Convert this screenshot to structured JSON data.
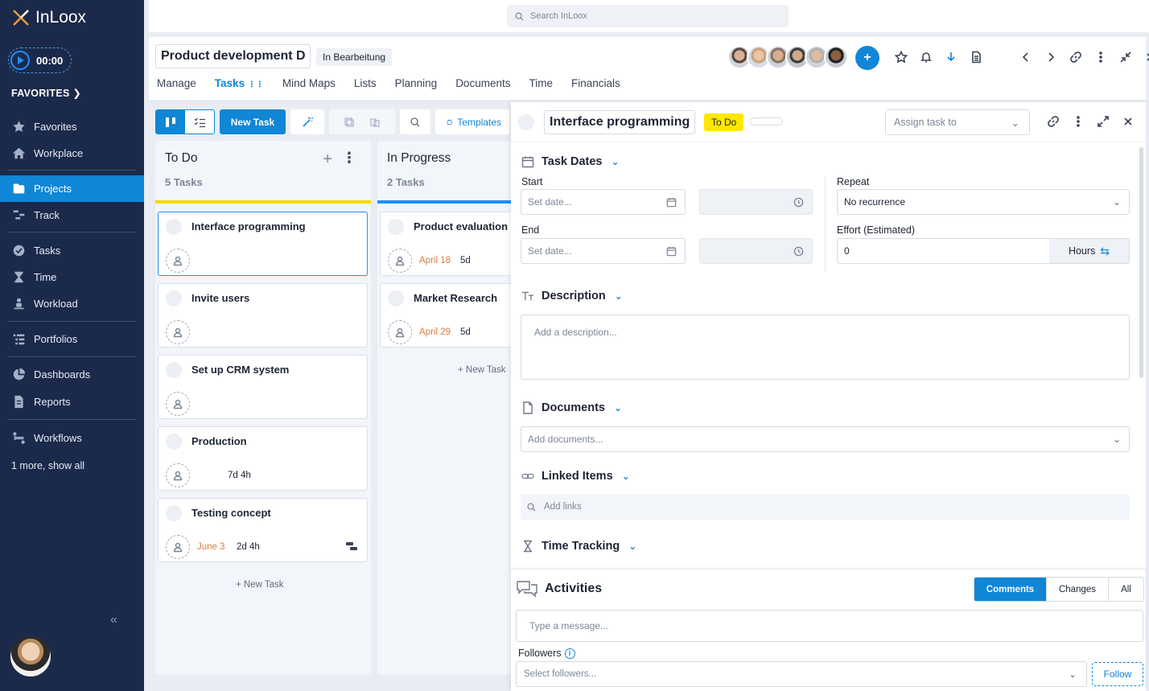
{
  "app": {
    "name": "InLoox"
  },
  "sidebar": {
    "timer": "00:00",
    "favorites_header": "FAVORITES",
    "items": [
      {
        "label": "Favorites",
        "icon": "star-icon"
      },
      {
        "label": "Workplace",
        "icon": "home-icon"
      },
      {
        "label": "Projects",
        "icon": "folder-icon",
        "active": true
      },
      {
        "label": "Track",
        "icon": "track-icon"
      },
      {
        "label": "Tasks",
        "icon": "check-circle-icon"
      },
      {
        "label": "Time",
        "icon": "hourglass-icon"
      },
      {
        "label": "Workload",
        "icon": "workload-icon"
      },
      {
        "label": "Portfolios",
        "icon": "portfolio-icon"
      },
      {
        "label": "Dashboards",
        "icon": "pie-chart-icon"
      },
      {
        "label": "Reports",
        "icon": "report-icon"
      },
      {
        "label": "Workflows",
        "icon": "workflow-icon"
      }
    ],
    "more": "1 more, show all"
  },
  "search": {
    "placeholder": "Search InLoox"
  },
  "project": {
    "title": "Product development D",
    "status": "In Bearbeitung",
    "tabs": [
      "Manage",
      "Tasks",
      "Mind Maps",
      "Lists",
      "Planning",
      "Documents",
      "Time",
      "Financials"
    ],
    "active_tab": "Tasks"
  },
  "toolbar": {
    "new_task": "New Task",
    "templates": "Templates"
  },
  "columns": [
    {
      "title": "To Do",
      "count": "5 Tasks",
      "bar_color": "#f5d90a",
      "cards": [
        {
          "title": "Interface programming",
          "date": "",
          "duration": ""
        },
        {
          "title": "Invite users",
          "date": "",
          "duration": ""
        },
        {
          "title": "Set up CRM system",
          "date": "",
          "duration": ""
        },
        {
          "title": "Production",
          "date": "",
          "duration": "7d 4h"
        },
        {
          "title": "Testing concept",
          "date": "June 3",
          "duration": "2d 4h"
        }
      ],
      "new_task": "New Task"
    },
    {
      "title": "In Progress",
      "count": "2 Tasks",
      "bar_color": "#1e90ff",
      "cards": [
        {
          "title": "Product evaluation",
          "date": "April 18",
          "duration": "5d"
        },
        {
          "title": "Market Research",
          "date": "April 29",
          "duration": "5d"
        }
      ],
      "new_task": "New Task"
    }
  ],
  "detail": {
    "title": "Interface programming",
    "status": "To Do",
    "assign_placeholder": "Assign task to",
    "task_dates": {
      "header": "Task Dates",
      "start_label": "Start",
      "end_label": "End",
      "date_placeholder": "Set date...",
      "repeat_label": "Repeat",
      "repeat_value": "No recurrence",
      "effort_label": "Effort (Estimated)",
      "effort_value": "0",
      "effort_unit": "Hours"
    },
    "description": {
      "header": "Description",
      "placeholder": "Add a description..."
    },
    "documents": {
      "header": "Documents",
      "placeholder": "Add documents..."
    },
    "linked_items": {
      "header": "Linked Items",
      "placeholder": "Add links"
    },
    "time_tracking": {
      "header": "Time Tracking"
    }
  },
  "activities": {
    "title": "Activities",
    "tabs": [
      "Comments",
      "Changes",
      "All"
    ],
    "active_tab": "Comments",
    "message_placeholder": "Type a message...",
    "followers_label": "Followers",
    "followers_placeholder": "Select followers...",
    "follow_button": "Follow"
  },
  "colors": {
    "accent": "#0f86d6",
    "sidebar": "#1b2a4a",
    "todo_status": "#ffe600",
    "date_orange": "#d97b3d"
  }
}
